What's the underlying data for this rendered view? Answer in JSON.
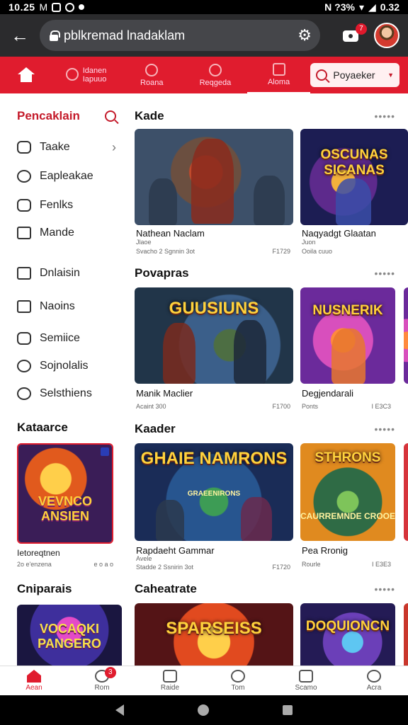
{
  "status_bar": {
    "time": "10.25",
    "left_glyphs": "M",
    "right_text": "N ?3%",
    "battery": "0.32"
  },
  "browser": {
    "url": "pblkremad lnadaklam",
    "notification_count": "7"
  },
  "topnav": {
    "tabs": [
      {
        "label_top": "Idanen",
        "label_bottom": "Iapuuo"
      },
      {
        "label": "Roana"
      },
      {
        "label": "Reqgeda"
      },
      {
        "label": "Aloma"
      }
    ],
    "search_value": "Poyaeker"
  },
  "sidebar": {
    "title": "Pencaklain",
    "items": [
      {
        "label": "Taake",
        "icon": "puzzle-icon",
        "chevron": "›"
      },
      {
        "label": "Eapleakae",
        "icon": "chat-icon"
      },
      {
        "label": "Fenlks",
        "icon": "gamepad-icon"
      },
      {
        "label": "Mande",
        "icon": "square-icon"
      },
      {
        "label": "Dnlaisin",
        "icon": "folder-icon"
      },
      {
        "label": "Naoins",
        "icon": "terminal-icon"
      },
      {
        "label": "Semiice",
        "icon": "wave-icon"
      },
      {
        "label": "Sojnolalis",
        "icon": "moon-icon"
      },
      {
        "label": "Selsthiens",
        "icon": "heart-icon"
      }
    ],
    "section2": {
      "title": "Kataarce",
      "card_logo": "VEVNCO ANSIEN",
      "card_caption": "Ietoreqtnen",
      "card_meta_left": "2o e'enzena",
      "card_meta_right": "e o a o"
    },
    "section3": {
      "title": "Cniparais",
      "card_logo": "VOCAQKI PANGERO"
    }
  },
  "sections": [
    {
      "title": "Kade",
      "more": "•••••",
      "cards": [
        {
          "logo": "",
          "sub": "",
          "caption": "Nathean Naclam",
          "meta_line1": "Jlaoe",
          "meta_left": "Svacho 2 Sgnnin 3ot",
          "meta_right": "F1729"
        },
        {
          "logo": "OSCUNAS SICANAS",
          "sub": "",
          "caption": "Naqyadgt Glaatan",
          "meta_line1": "Juon",
          "meta_left": "Ooila cuuo",
          "meta_right": ""
        }
      ]
    },
    {
      "title": "Povapras",
      "more": "•••••",
      "cards": [
        {
          "logo": "GUUSIUNS",
          "sub": "",
          "caption": "Manik Maclier",
          "meta_left": "Acaint 300",
          "meta_right": "F1700"
        },
        {
          "logo": "NUSNERIK",
          "sub": "",
          "caption": "Degjendarali",
          "meta_left": "Ponts",
          "meta_right": "I E3C3"
        }
      ]
    },
    {
      "title": "Kaader",
      "more": "•••••",
      "cards": [
        {
          "logo": "GHAIE NAMRONS",
          "sub": "GRAEENIRONS",
          "caption": "Rapdaeht Gammar",
          "meta_line1": "Avele",
          "meta_left": "Stadde 2 Ssnirin 3ot",
          "meta_right": "F1720"
        },
        {
          "logo": "STHRONS",
          "sub": "CAURREMNDE CROOE",
          "caption": "Pea Rronig",
          "meta_left": "Rourle",
          "meta_right": "I E3E3"
        }
      ]
    },
    {
      "title": "Caheatrate",
      "more": "•••••",
      "cards": [
        {
          "logo": "SPARSEISS",
          "sub": ""
        },
        {
          "logo": "DOQUIONCN",
          "sub": ""
        }
      ]
    }
  ],
  "bottom_nav": [
    {
      "label": "Aean",
      "icon": "home-icon",
      "active": true
    },
    {
      "label": "Rom",
      "icon": "chat-icon",
      "badge": "3"
    },
    {
      "label": "Raide",
      "icon": "house-outline-icon"
    },
    {
      "label": "Tom",
      "icon": "search-icon"
    },
    {
      "label": "Scamo",
      "icon": "edit-icon"
    },
    {
      "label": "Acra",
      "icon": "profile-icon"
    }
  ],
  "colors": {
    "brand_red": "#e01c2e",
    "browser_bar": "#2b2b2d"
  }
}
